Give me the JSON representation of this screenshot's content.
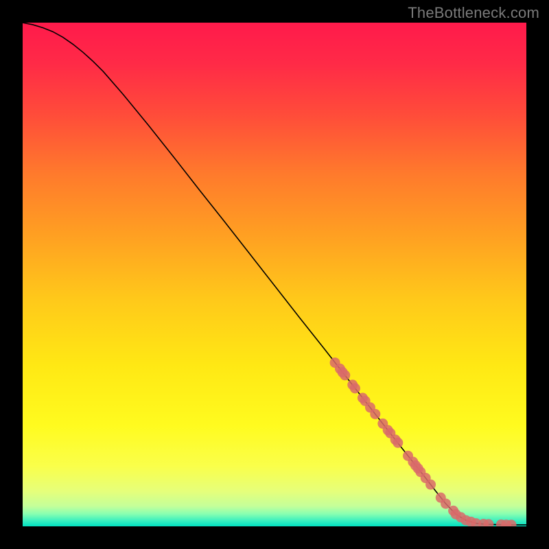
{
  "watermark": "TheBottleneck.com",
  "chart_data": {
    "type": "line",
    "title": "",
    "xlabel": "",
    "ylabel": "",
    "xlim": [
      0,
      100
    ],
    "ylim": [
      0,
      100
    ],
    "grid": false,
    "legend": false,
    "series": [
      {
        "name": "curve",
        "style": "line",
        "color": "#000000",
        "x": [
          0,
          2,
          4,
          6,
          8,
          10,
          12,
          14,
          16,
          20,
          25,
          30,
          35,
          40,
          45,
          50,
          55,
          60,
          65,
          70,
          75,
          80,
          82,
          84,
          86,
          88,
          90,
          92,
          94,
          96,
          98,
          100
        ],
        "y": [
          100,
          99.6,
          99.0,
          98.2,
          97.1,
          95.7,
          94.1,
          92.3,
          90.3,
          85.7,
          79.6,
          73.3,
          66.9,
          60.6,
          54.2,
          47.8,
          41.4,
          35.1,
          28.7,
          22.3,
          15.9,
          9.6,
          7.0,
          4.5,
          2.4,
          1.2,
          0.6,
          0.4,
          0.35,
          0.3,
          0.3,
          0.3
        ]
      },
      {
        "name": "markers",
        "style": "scatter",
        "color": "#d96a6a",
        "x": [
          62,
          63,
          63.5,
          64,
          65.5,
          66,
          67.5,
          68,
          69,
          70,
          71.5,
          72.5,
          73,
          74,
          74.5,
          76.5,
          77.5,
          78,
          78.5,
          79,
          80,
          81,
          83,
          84,
          85.5,
          86,
          87,
          88,
          89,
          90,
          91.5,
          92.5,
          95,
          96,
          97
        ],
        "y": [
          32.5,
          31.3,
          30.6,
          30.0,
          28.1,
          27.4,
          25.5,
          24.9,
          23.6,
          22.3,
          20.4,
          19.1,
          18.5,
          17.2,
          16.6,
          14.0,
          12.8,
          12.1,
          11.5,
          10.8,
          9.6,
          8.3,
          5.7,
          4.5,
          3.1,
          2.4,
          1.8,
          1.2,
          0.9,
          0.6,
          0.48,
          0.42,
          0.35,
          0.33,
          0.31
        ]
      }
    ],
    "background_gradient": {
      "stops": [
        {
          "offset": 0.0,
          "color": "#ff1a4b"
        },
        {
          "offset": 0.08,
          "color": "#ff2a47"
        },
        {
          "offset": 0.18,
          "color": "#ff4b3a"
        },
        {
          "offset": 0.3,
          "color": "#ff7a2c"
        },
        {
          "offset": 0.42,
          "color": "#ff9f22"
        },
        {
          "offset": 0.55,
          "color": "#ffc91a"
        },
        {
          "offset": 0.68,
          "color": "#ffe814"
        },
        {
          "offset": 0.8,
          "color": "#fffb1f"
        },
        {
          "offset": 0.88,
          "color": "#faff4a"
        },
        {
          "offset": 0.93,
          "color": "#e6ff7a"
        },
        {
          "offset": 0.96,
          "color": "#c4ff9a"
        },
        {
          "offset": 0.975,
          "color": "#8affb0"
        },
        {
          "offset": 0.99,
          "color": "#33eec0"
        },
        {
          "offset": 1.0,
          "color": "#00e0c0"
        }
      ]
    }
  }
}
